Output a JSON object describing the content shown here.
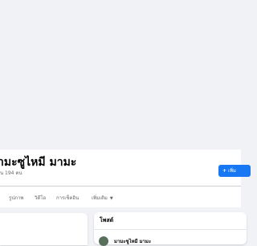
{
  "profile": {
    "name": "ามะซูไหมี มามะ",
    "subtitle": "น 194 คน",
    "add_friend_label": "เพิ่ม",
    "add_friend_icon": "plus-icon"
  },
  "tabs": [
    {
      "label": "รูปภาพ"
    },
    {
      "label": "วิดีโอ"
    },
    {
      "label": "การเช็คอิน"
    },
    {
      "label": "เพิ่มเติม",
      "icon": "chevron-down-icon"
    }
  ],
  "posts": {
    "title": "โพสต์",
    "author": "มามะซูไหมี มามะ"
  },
  "colors": {
    "accent": "#1877f2",
    "background": "#f0f2f5",
    "card": "#ffffff"
  }
}
